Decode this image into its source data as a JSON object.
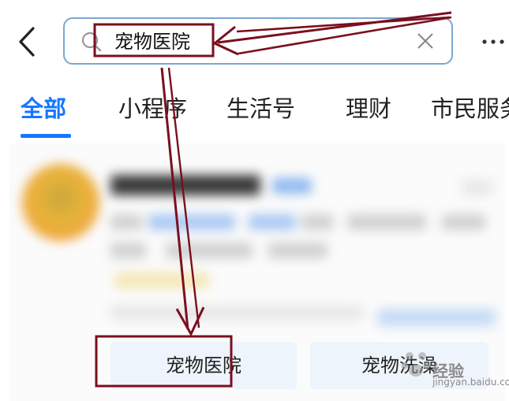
{
  "search": {
    "query": "宠物医院"
  },
  "tabs": [
    {
      "label": "全部",
      "active": true
    },
    {
      "label": "小程序"
    },
    {
      "label": "生活号"
    },
    {
      "label": "理财"
    },
    {
      "label": "市民服务"
    }
  ],
  "suggestions": [
    {
      "label": "宠物医院"
    },
    {
      "label": "宠物洗澡"
    }
  ],
  "watermark": {
    "text": "经验",
    "url": "jingyan.baidu.com"
  },
  "colors": {
    "accent": "#1677ff",
    "annotation": "#7a0f1e",
    "search_border": "#7aa7d2"
  },
  "icons": [
    "back-icon",
    "search-icon",
    "clear-icon",
    "more-icon"
  ]
}
